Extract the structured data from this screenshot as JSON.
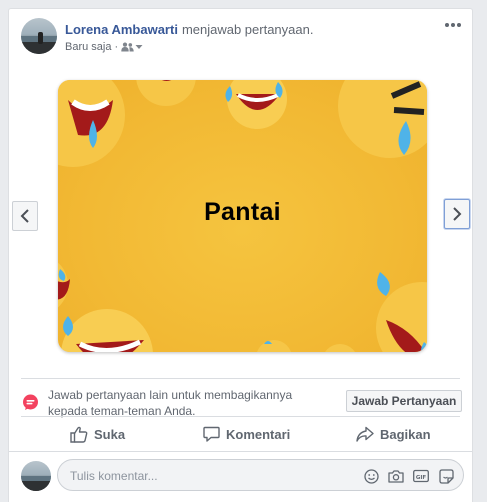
{
  "post": {
    "author_name": "Lorena Ambawarti",
    "action_text": "menjawab pertanyaan.",
    "timestamp": "Baru saja",
    "separator": "·",
    "privacy_icon": "friends-icon"
  },
  "slide": {
    "text": "Pantai",
    "background_color": "#f2b934"
  },
  "prompt": {
    "text": "Jawab pertanyaan lain untuk membagikannya kepada teman-teman Anda.",
    "button_label": "Jawab Pertanyaan"
  },
  "actions": {
    "like": "Suka",
    "comment": "Komentari",
    "share": "Bagikan"
  },
  "comment_box": {
    "placeholder": "Tulis komentar...",
    "icons": [
      "emoji-icon",
      "camera-icon",
      "gif-icon",
      "sticker-icon"
    ]
  },
  "colors": {
    "link_blue": "#385898",
    "muted_text": "#616770",
    "prompt_icon": "#f3425f"
  }
}
